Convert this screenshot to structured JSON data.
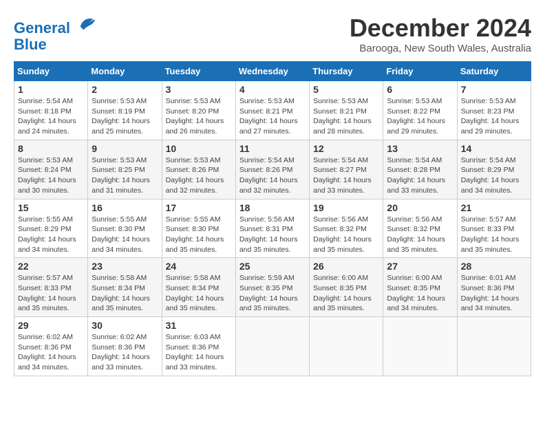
{
  "logo": {
    "line1": "General",
    "line2": "Blue"
  },
  "title": "December 2024",
  "subtitle": "Barooga, New South Wales, Australia",
  "weekdays": [
    "Sunday",
    "Monday",
    "Tuesday",
    "Wednesday",
    "Thursday",
    "Friday",
    "Saturday"
  ],
  "weeks": [
    [
      {
        "day": "1",
        "sunrise": "5:54 AM",
        "sunset": "8:18 PM",
        "daylight": "14 hours and 24 minutes."
      },
      {
        "day": "2",
        "sunrise": "5:53 AM",
        "sunset": "8:19 PM",
        "daylight": "14 hours and 25 minutes."
      },
      {
        "day": "3",
        "sunrise": "5:53 AM",
        "sunset": "8:20 PM",
        "daylight": "14 hours and 26 minutes."
      },
      {
        "day": "4",
        "sunrise": "5:53 AM",
        "sunset": "8:21 PM",
        "daylight": "14 hours and 27 minutes."
      },
      {
        "day": "5",
        "sunrise": "5:53 AM",
        "sunset": "8:21 PM",
        "daylight": "14 hours and 28 minutes."
      },
      {
        "day": "6",
        "sunrise": "5:53 AM",
        "sunset": "8:22 PM",
        "daylight": "14 hours and 29 minutes."
      },
      {
        "day": "7",
        "sunrise": "5:53 AM",
        "sunset": "8:23 PM",
        "daylight": "14 hours and 29 minutes."
      }
    ],
    [
      {
        "day": "8",
        "sunrise": "5:53 AM",
        "sunset": "8:24 PM",
        "daylight": "14 hours and 30 minutes."
      },
      {
        "day": "9",
        "sunrise": "5:53 AM",
        "sunset": "8:25 PM",
        "daylight": "14 hours and 31 minutes."
      },
      {
        "day": "10",
        "sunrise": "5:53 AM",
        "sunset": "8:26 PM",
        "daylight": "14 hours and 32 minutes."
      },
      {
        "day": "11",
        "sunrise": "5:54 AM",
        "sunset": "8:26 PM",
        "daylight": "14 hours and 32 minutes."
      },
      {
        "day": "12",
        "sunrise": "5:54 AM",
        "sunset": "8:27 PM",
        "daylight": "14 hours and 33 minutes."
      },
      {
        "day": "13",
        "sunrise": "5:54 AM",
        "sunset": "8:28 PM",
        "daylight": "14 hours and 33 minutes."
      },
      {
        "day": "14",
        "sunrise": "5:54 AM",
        "sunset": "8:29 PM",
        "daylight": "14 hours and 34 minutes."
      }
    ],
    [
      {
        "day": "15",
        "sunrise": "5:55 AM",
        "sunset": "8:29 PM",
        "daylight": "14 hours and 34 minutes."
      },
      {
        "day": "16",
        "sunrise": "5:55 AM",
        "sunset": "8:30 PM",
        "daylight": "14 hours and 34 minutes."
      },
      {
        "day": "17",
        "sunrise": "5:55 AM",
        "sunset": "8:30 PM",
        "daylight": "14 hours and 35 minutes."
      },
      {
        "day": "18",
        "sunrise": "5:56 AM",
        "sunset": "8:31 PM",
        "daylight": "14 hours and 35 minutes."
      },
      {
        "day": "19",
        "sunrise": "5:56 AM",
        "sunset": "8:32 PM",
        "daylight": "14 hours and 35 minutes."
      },
      {
        "day": "20",
        "sunrise": "5:56 AM",
        "sunset": "8:32 PM",
        "daylight": "14 hours and 35 minutes."
      },
      {
        "day": "21",
        "sunrise": "5:57 AM",
        "sunset": "8:33 PM",
        "daylight": "14 hours and 35 minutes."
      }
    ],
    [
      {
        "day": "22",
        "sunrise": "5:57 AM",
        "sunset": "8:33 PM",
        "daylight": "14 hours and 35 minutes."
      },
      {
        "day": "23",
        "sunrise": "5:58 AM",
        "sunset": "8:34 PM",
        "daylight": "14 hours and 35 minutes."
      },
      {
        "day": "24",
        "sunrise": "5:58 AM",
        "sunset": "8:34 PM",
        "daylight": "14 hours and 35 minutes."
      },
      {
        "day": "25",
        "sunrise": "5:59 AM",
        "sunset": "8:35 PM",
        "daylight": "14 hours and 35 minutes."
      },
      {
        "day": "26",
        "sunrise": "6:00 AM",
        "sunset": "8:35 PM",
        "daylight": "14 hours and 35 minutes."
      },
      {
        "day": "27",
        "sunrise": "6:00 AM",
        "sunset": "8:35 PM",
        "daylight": "14 hours and 34 minutes."
      },
      {
        "day": "28",
        "sunrise": "6:01 AM",
        "sunset": "8:36 PM",
        "daylight": "14 hours and 34 minutes."
      }
    ],
    [
      {
        "day": "29",
        "sunrise": "6:02 AM",
        "sunset": "8:36 PM",
        "daylight": "14 hours and 34 minutes."
      },
      {
        "day": "30",
        "sunrise": "6:02 AM",
        "sunset": "8:36 PM",
        "daylight": "14 hours and 33 minutes."
      },
      {
        "day": "31",
        "sunrise": "6:03 AM",
        "sunset": "8:36 PM",
        "daylight": "14 hours and 33 minutes."
      },
      null,
      null,
      null,
      null
    ]
  ]
}
